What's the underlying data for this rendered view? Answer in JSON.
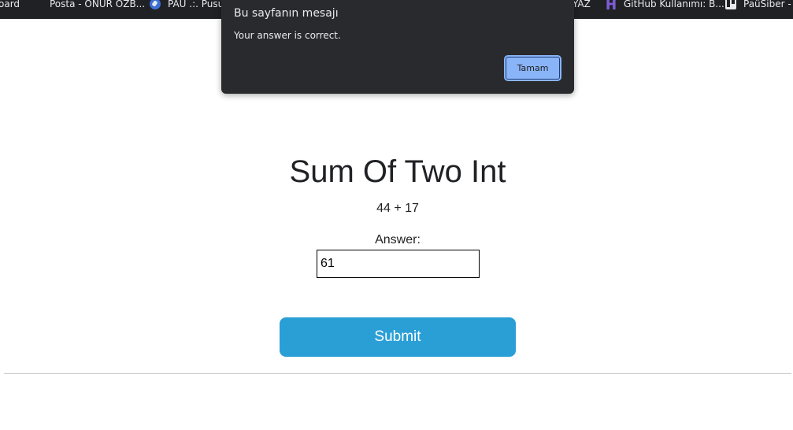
{
  "bookmarks": [
    {
      "label": "oard",
      "icon": "none"
    },
    {
      "label": "Posta - ONUR ÖZB...",
      "icon": "microsoft-icon"
    },
    {
      "label": "PAU .:. Pusula",
      "icon": "compass-icon"
    },
    {
      "label": "YAZ",
      "icon": "none"
    },
    {
      "label": "GitHub Kullanımı: B...",
      "icon": "hex-icon"
    },
    {
      "label": "PaüSiber - Ç",
      "icon": "trello-icon"
    }
  ],
  "dialog": {
    "title": "Bu sayfanın mesajı",
    "message": "Your answer is correct.",
    "ok_label": "Tamam"
  },
  "page": {
    "title": "Sum Of Two Int",
    "question": "44 + 17",
    "answer_label": "Answer:",
    "answer_value": "61",
    "submit_label": "Submit"
  },
  "colors": {
    "submit": "#2a9fd6",
    "dialog_bg": "#292a2d",
    "dialog_button": "#8ab4f8",
    "bookmarks_bg": "#202124"
  }
}
